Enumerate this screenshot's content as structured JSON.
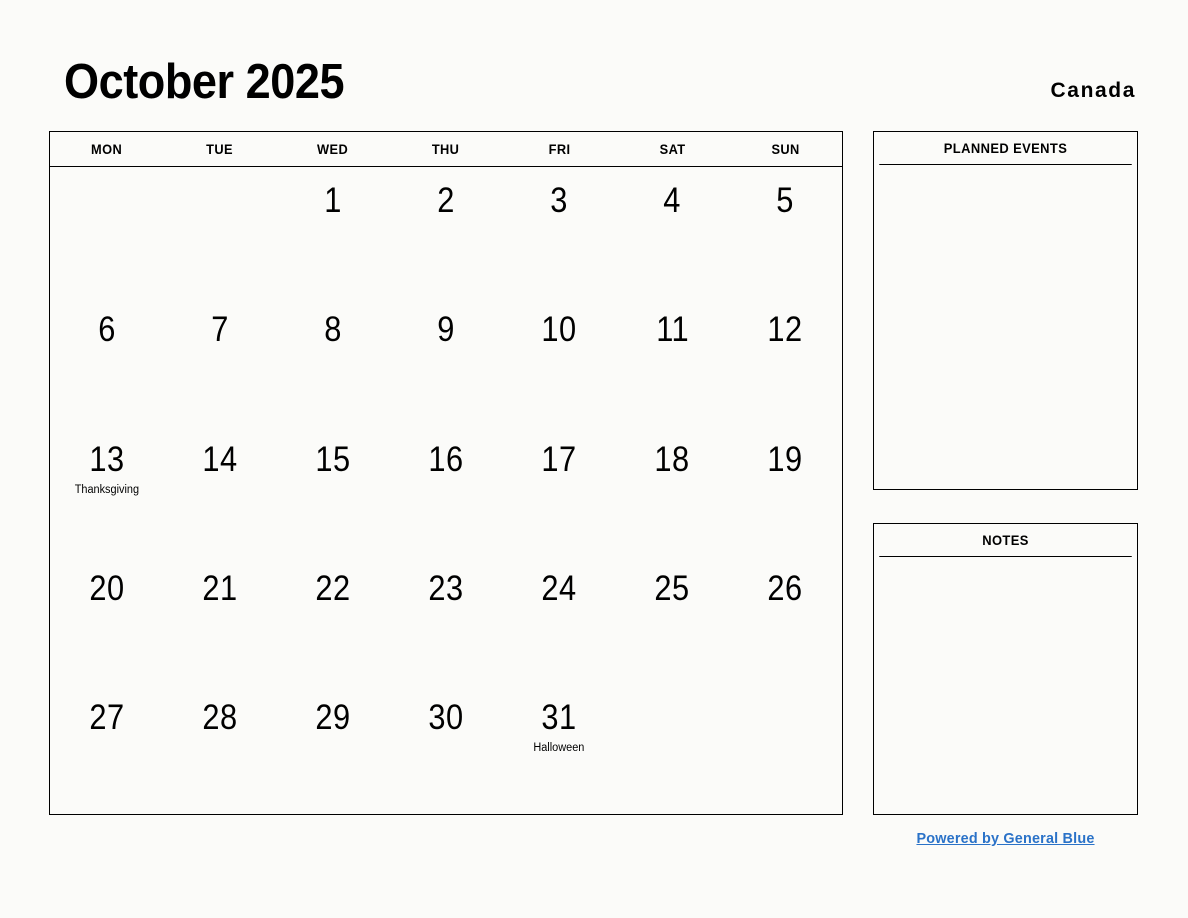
{
  "header": {
    "title": "October 2025",
    "country": "Canada"
  },
  "calendar": {
    "weekdays": [
      "MON",
      "TUE",
      "WED",
      "THU",
      "FRI",
      "SAT",
      "SUN"
    ],
    "weeks": [
      [
        {
          "day": "",
          "event": ""
        },
        {
          "day": "",
          "event": ""
        },
        {
          "day": "1",
          "event": ""
        },
        {
          "day": "2",
          "event": ""
        },
        {
          "day": "3",
          "event": ""
        },
        {
          "day": "4",
          "event": ""
        },
        {
          "day": "5",
          "event": ""
        }
      ],
      [
        {
          "day": "6",
          "event": ""
        },
        {
          "day": "7",
          "event": ""
        },
        {
          "day": "8",
          "event": ""
        },
        {
          "day": "9",
          "event": ""
        },
        {
          "day": "10",
          "event": ""
        },
        {
          "day": "11",
          "event": ""
        },
        {
          "day": "12",
          "event": ""
        }
      ],
      [
        {
          "day": "13",
          "event": "Thanksgiving"
        },
        {
          "day": "14",
          "event": ""
        },
        {
          "day": "15",
          "event": ""
        },
        {
          "day": "16",
          "event": ""
        },
        {
          "day": "17",
          "event": ""
        },
        {
          "day": "18",
          "event": ""
        },
        {
          "day": "19",
          "event": ""
        }
      ],
      [
        {
          "day": "20",
          "event": ""
        },
        {
          "day": "21",
          "event": ""
        },
        {
          "day": "22",
          "event": ""
        },
        {
          "day": "23",
          "event": ""
        },
        {
          "day": "24",
          "event": ""
        },
        {
          "day": "25",
          "event": ""
        },
        {
          "day": "26",
          "event": ""
        }
      ],
      [
        {
          "day": "27",
          "event": ""
        },
        {
          "day": "28",
          "event": ""
        },
        {
          "day": "29",
          "event": ""
        },
        {
          "day": "30",
          "event": ""
        },
        {
          "day": "31",
          "event": "Halloween"
        },
        {
          "day": "",
          "event": ""
        },
        {
          "day": "",
          "event": ""
        }
      ]
    ]
  },
  "panels": {
    "planned_events": {
      "title": "PLANNED EVENTS",
      "content": ""
    },
    "notes": {
      "title": "NOTES",
      "content": ""
    }
  },
  "footer": {
    "link_label": "Powered by General Blue",
    "link_color": "#2a72c8"
  }
}
